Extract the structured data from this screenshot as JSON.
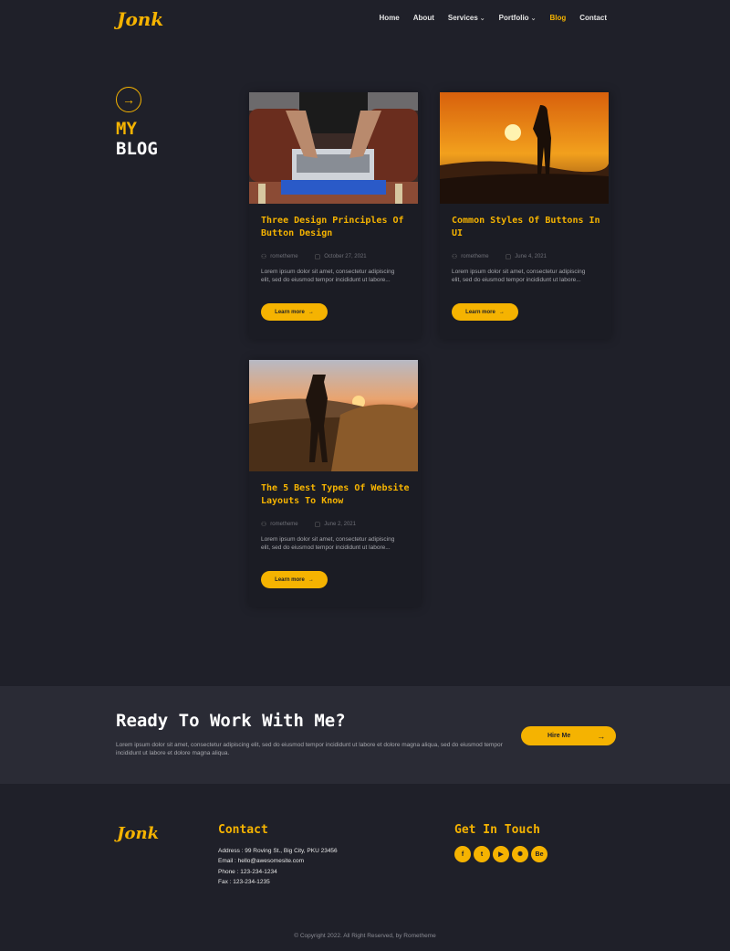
{
  "brand": {
    "logo": "Jonk"
  },
  "nav": {
    "items": [
      {
        "label": "Home"
      },
      {
        "label": "About"
      },
      {
        "label": "Services",
        "chevron": "⌄"
      },
      {
        "label": "Portfolio",
        "chevron": "⌄"
      },
      {
        "label": "Blog",
        "active": true
      },
      {
        "label": "Contact"
      }
    ]
  },
  "page": {
    "arrow_icon": "→",
    "title_line1": "MY",
    "title_line2": "BLOG"
  },
  "posts": [
    {
      "title": "Three Design Principles Of Button Design",
      "author": "rometheme",
      "date": "October 27, 2021",
      "excerpt": "Lorem ipsum dolor sit amet, consectetur adipiscing elit, sed do eiusmod tempor incididunt ut labore...",
      "button": "Learn more",
      "button_icon": "→",
      "image": "laptop-photo"
    },
    {
      "title": "Common Styles Of Buttons In UI",
      "author": "rometheme",
      "date": "June 4, 2021",
      "excerpt": "Lorem ipsum dolor sit amet, consectetur adipiscing elit, sed do eiusmod tempor incididunt ut labore...",
      "button": "Learn more",
      "button_icon": "→",
      "image": "sunset-photographer-photo"
    },
    {
      "title": "The 5 Best Types Of Website Layouts To Know",
      "author": "rometheme",
      "date": "June 2, 2021",
      "excerpt": "Lorem ipsum dolor sit amet, consectetur adipiscing elit, sed do eiusmod tempor incididunt ut labore...",
      "button": "Learn more",
      "button_icon": "→",
      "image": "hiker-sunset-photo"
    }
  ],
  "cta": {
    "title": "Ready To Work With Me?",
    "text": "Lorem ipsum dolor sit amet, consectetur adipiscing elit, sed do eiusmod tempor incididunt ut labore et dolore magna aliqua, sed do eiusmod tempor incididunt ut labore et dolore magna aliqua.",
    "button": "Hire Me",
    "button_icon": "→"
  },
  "footer": {
    "logo": "Jonk",
    "contact_heading": "Contact",
    "contact_lines": [
      "Address : 99 Roving St., Big City, PKU 23456",
      "Email : hello@awesomesite.com",
      "Phone : 123-234-1234",
      "Fax : 123-234-1235"
    ],
    "social_heading": "Get In Touch",
    "socials": [
      {
        "name": "facebook-icon",
        "glyph": "f"
      },
      {
        "name": "twitter-icon",
        "glyph": "t"
      },
      {
        "name": "youtube-icon",
        "glyph": "▶"
      },
      {
        "name": "dribbble-icon",
        "glyph": "✺"
      },
      {
        "name": "behance-icon",
        "glyph": "Be"
      }
    ],
    "copyright": "© Copyright 2022. All Right Reserved, by Rometheme"
  },
  "colors": {
    "accent": "#f5b301",
    "background": "#1f2029",
    "card": "#1b1c24",
    "cta": "#2a2b35"
  }
}
